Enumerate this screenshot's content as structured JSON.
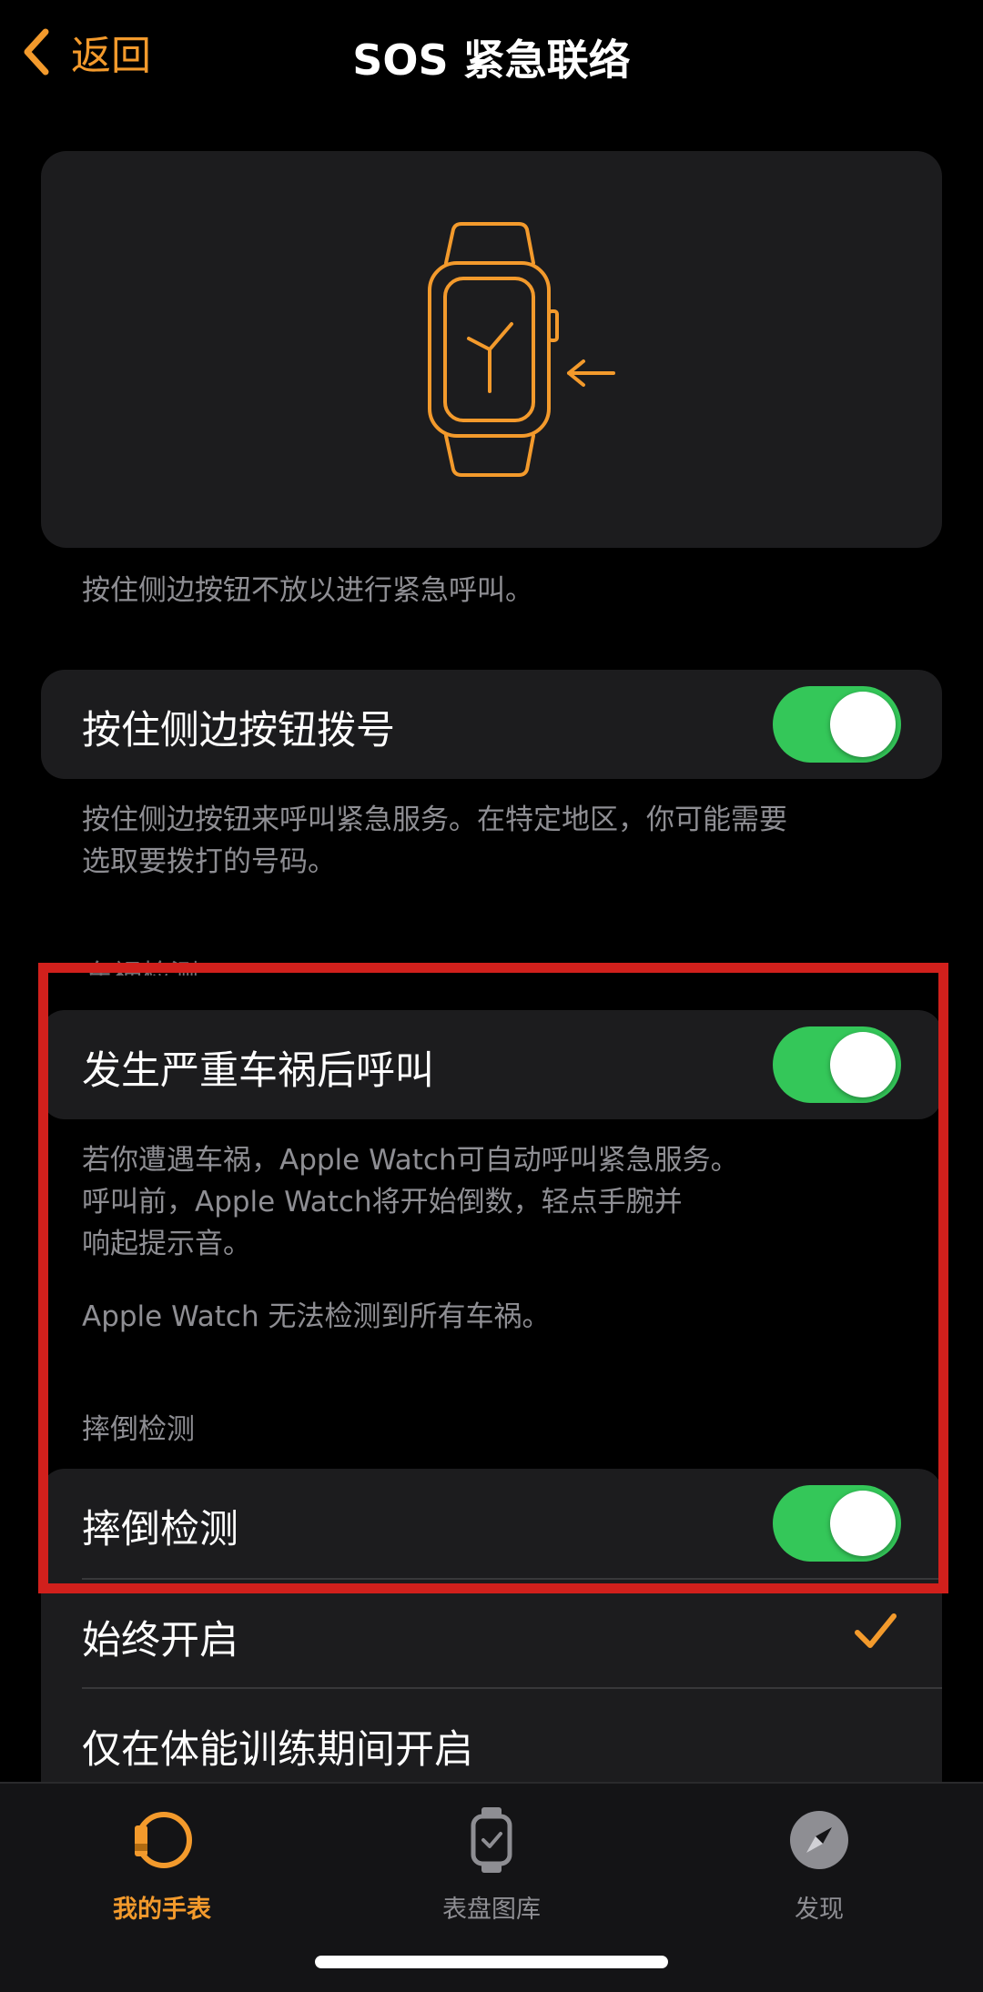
{
  "nav": {
    "back_label": "返回",
    "title": "SOS 紧急联络"
  },
  "hero": {
    "icon": "apple-watch-side-button-illustration",
    "caption": "按住侧边按钮不放以进行紧急呼叫。"
  },
  "side_button_call": {
    "label": "按住侧边按钮拨号",
    "enabled": true,
    "footer_line1": "按住侧边按钮来呼叫紧急服务。在特定地区，你可能需要",
    "footer_line2": "选取要拨打的号码。"
  },
  "crash_detection": {
    "header": "车祸检测",
    "label": "发生严重车祸后呼叫",
    "enabled": true,
    "footer_line1": "若你遭遇车祸，Apple Watch可自动呼叫紧急服务。",
    "footer_line2": "呼叫前，Apple Watch将开始倒数，轻点手腕并",
    "footer_line3": "响起提示音。",
    "footer_note": "Apple Watch 无法检测到所有车祸。"
  },
  "fall_detection": {
    "header": "摔倒检测",
    "label": "摔倒检测",
    "enabled": true,
    "options": [
      {
        "label": "始终开启",
        "selected": true
      },
      {
        "label": "仅在体能训练期间开启",
        "selected": false
      }
    ]
  },
  "tabbar": {
    "tabs": [
      {
        "label": "我的手表",
        "icon": "watch-face-icon",
        "active": true
      },
      {
        "label": "表盘图库",
        "icon": "watch-gallery-icon",
        "active": false
      },
      {
        "label": "发现",
        "icon": "compass-icon",
        "active": false
      }
    ]
  },
  "colors": {
    "accent": "#f39a2c",
    "toggle_on": "#34c759",
    "highlight": "#d1201c"
  }
}
